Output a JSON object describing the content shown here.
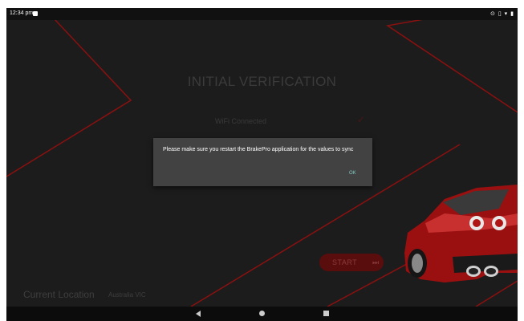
{
  "status_bar": {
    "time": "12:34 pm"
  },
  "main": {
    "title": "INITIAL VERIFICATION",
    "wifi_label": "WiFi Connected",
    "wifi_check": "✓",
    "start_label": "START",
    "start_icon": "⏭",
    "location_label": "Current Location",
    "location_value": "Australia VIC"
  },
  "dialog": {
    "message": "Please make sure you restart the BrakePro application for the values to sync",
    "ok_label": "OK"
  },
  "colors": {
    "background": "#1c1c1c",
    "accent_red": "#8b0000",
    "start_button": "#5a0d0d",
    "dialog_bg": "#424242",
    "dialog_ok": "#80cbc4"
  },
  "icons": {
    "status_left": "image-icon",
    "status_right": [
      "location-icon",
      "vibrate-icon",
      "wifi-icon",
      "battery-icon"
    ],
    "nav": [
      "back-icon",
      "home-icon",
      "recents-icon"
    ]
  }
}
